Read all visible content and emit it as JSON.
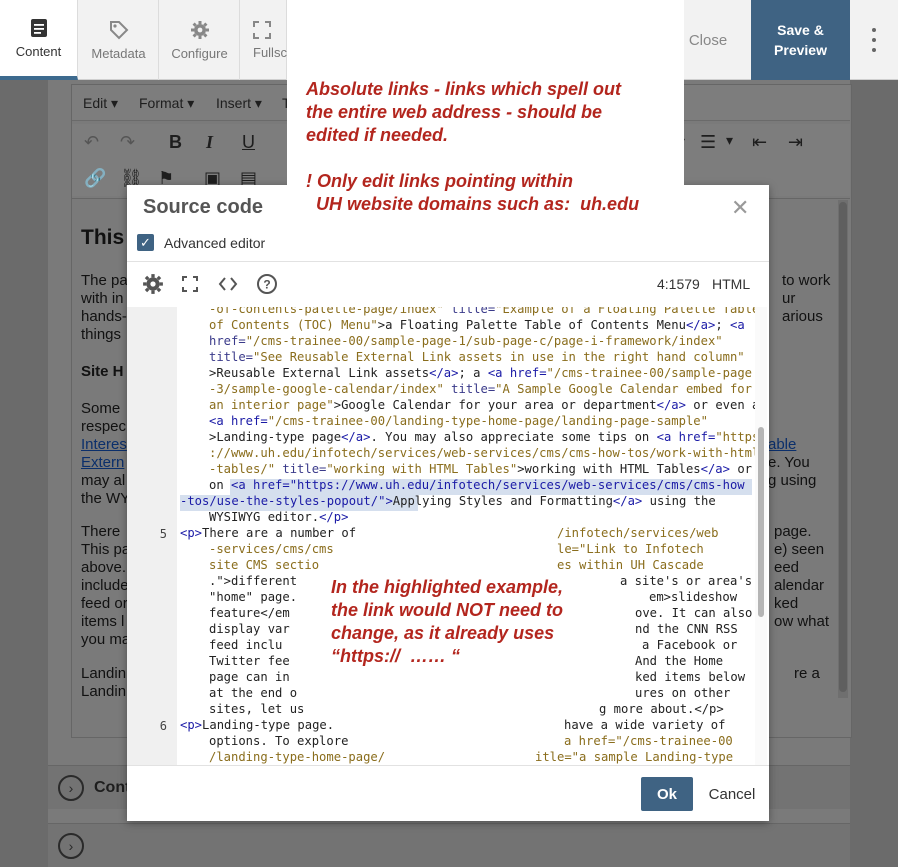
{
  "toolbar": {
    "content": "Content",
    "metadata": "Metadata",
    "configure": "Configure",
    "fullscreen": "Fullscr",
    "close": "Close",
    "save_preview_1": "Save &",
    "save_preview_2": "Preview"
  },
  "editor_menu": {
    "edit": "Edit",
    "format": "Format",
    "insert": "Insert",
    "t": "T"
  },
  "background_text": {
    "heading": "This",
    "p1_l1": "The pa",
    "p1_l2": "with in",
    "p1_l3": "hands-",
    "p1_l4": "things",
    "p1_r1": "to work",
    "p1_r2": "ur",
    "p1_r3": "arious",
    "site_heading": "Site H",
    "p2_l1": "Some",
    "p2_l2": "respec",
    "p2_l3": "Interes",
    "p2_l4": "Extern",
    "p2_l5": "may al",
    "p2_l6": "the WY",
    "p2_r1": "able",
    "p2_r2": "e. You",
    "p2_r3": "g using",
    "p3_l1": "There",
    "p3_l2": "This pa",
    "p3_l3": "above.",
    "p3_l4": "include",
    "p3_l5": "feed or",
    "p3_l6": "items l",
    "p3_l7": "you ma",
    "p3_r1": "page.",
    "p3_r2": "e) seen",
    "p3_r3": "eed",
    "p3_r4": "alendar",
    "p3_r5": "ked",
    "p3_r6": "ow what",
    "p4_l1": "Landin",
    "p4_l2": "Landin",
    "p4_r1": "re a"
  },
  "panels": {
    "content": "Cont"
  },
  "dialog": {
    "title": "Source code",
    "advanced_editor": "Advanced editor",
    "cursor_pos": "4:1579",
    "mode": "HTML",
    "ok": "Ok",
    "cancel": "Cancel",
    "line_numbers": [
      "5",
      "6"
    ]
  },
  "code": {
    "l01_a": "-of-contents-palette-page/index\" ",
    "l01_b": "title=",
    "l01_c": "\"Example of a Floating Palette Table",
    "l02_a": "of Contents (TOC) Menu\"",
    "l02_b": ">a Floating Palette Table of Contents Menu",
    "l02_c": "</a>",
    "l02_d": "; ",
    "l02_e": "<a",
    "l03_a": "href=",
    "l03_b": "\"/cms-trainee-00/sample-page-1/sub-page-c/page-i-framework/index\"",
    "l04_a": "title=",
    "l04_b": "\"See Reusable External Link assets in use in the right hand column\"",
    "l05_a": ">Reusable External Link assets",
    "l05_b": "</a>",
    "l05_c": "; a ",
    "l05_d": "<a href=",
    "l05_e": "\"/cms-trainee-00/sample-page",
    "l06_a": "-3/sample-google-calendar/index\" ",
    "l06_b": "title=",
    "l06_c": "\"A Sample Google Calendar embed for",
    "l07_a": "an interior page\"",
    "l07_b": ">Google Calendar for your area or department",
    "l07_c": "</a>",
    "l07_d": " or even a",
    "l08_a": "<a href=",
    "l08_b": "\"/cms-trainee-00/landing-type-home-page/landing-page-sample\"",
    "l09_a": ">Landing-type page",
    "l09_b": "</a>",
    "l09_c": ". You may also appreciate some tips on ",
    "l09_d": "<a href=",
    "l09_e": "\"https",
    "l10_a": "://www.uh.edu/infotech/services/web-services/cms/cms-how-tos/work-with-html",
    "l11_a": "-tables/\" ",
    "l11_b": "title=",
    "l11_c": "\"working with HTML Tables\"",
    "l11_d": ">working with HTML Tables",
    "l11_e": "</a>",
    "l11_f": " or",
    "l12_a": "on ",
    "l12_b": "<a href=\"https://www.uh.edu/infotech/services/web-services/cms/cms-how",
    "l13_a": "-tos/use-the-styles-popout/\">",
    "l13_b": "Applying Styles and Formatting",
    "l13_c": "</a>",
    "l13_d": " using the",
    "l14_a": "WYSIWYG editor.",
    "l14_b": "</p>",
    "l15_a": "<p>",
    "l15_b": "There are a number of",
    "l15_c": "/infotech/services/web",
    "l16_a": "-services/cms/cms",
    "l16_b": "le=\"Link to Infotech",
    "l17_a": "site CMS sectio",
    "l17_b": "es within UH Cascade",
    "l18_a": ".\">different",
    "l18_b": "a site's or area's",
    "l19_a": "\"home\" page.",
    "l19_b": "em>slideshow",
    "l20_a": "feature</em",
    "l20_b": "ove. It can also",
    "l21_a": "display var",
    "l21_b": "nd the CNN RSS",
    "l22_a": "feed inclu",
    "l22_b": "a Facebook or",
    "l23_a": "Twitter fee",
    "l23_b": "And the Home",
    "l24_a": "page can in",
    "l24_b": "ked items below",
    "l25_a": "at the end o",
    "l25_b": "ures on other",
    "l26_a": "sites, let us",
    "l26_b": "g more about.</p>",
    "l27_a": "<p>",
    "l27_b": "Landing-type page.",
    "l27_c": "have a wide variety of",
    "l28_a": "options. To explore",
    "l28_b": "a href=\"/cms-trainee-00",
    "l29_a": "/landing-type-home-page/",
    "l29_b": "itle=\"a sample Landing-type"
  },
  "annotations": {
    "top_1": "Absolute links - links which spell out",
    "top_2": "the entire web address - should be",
    "top_3": "edited if needed.",
    "top_4": "! Only edit links pointing within",
    "top_5": "  UH website domains such as:  uh.edu",
    "mid_1": "In the highlighted example,",
    "mid_2": "the link would NOT need to",
    "mid_3": "change, as it already uses",
    "mid_4": "“https://  …… “"
  },
  "colors": {
    "accent": "#3f6383",
    "annotation": "#b3261e",
    "highlight": "#d5dfee"
  }
}
